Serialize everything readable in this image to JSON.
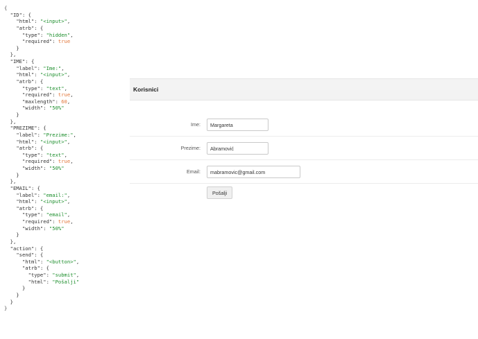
{
  "code": {
    "ID_key": "\"ID\"",
    "ID_html": "\"<input>\"",
    "ID_type": "\"hidden\"",
    "ID_required": "true",
    "IME_key": "\"IME\"",
    "IME_label": "\"Ime:\"",
    "IME_html": "\"<input>\"",
    "IME_type": "\"text\"",
    "IME_required": "true",
    "IME_maxlength": "60",
    "IME_width": "\"50%\"",
    "PREZIME_key": "\"PREZIME\"",
    "PREZIME_label": "\"Prezime:\"",
    "PREZIME_html": "\"<input>\"",
    "PREZIME_type": "\"text\"",
    "PREZIME_required": "true",
    "PREZIME_width": "\"50%\"",
    "EMAIL_key": "\"EMAIL\"",
    "EMAIL_label": "\"email:\"",
    "EMAIL_html": "\"<input>\"",
    "EMAIL_type": "\"email\"",
    "EMAIL_required": "true",
    "EMAIL_width": "\"50%\"",
    "action_key": "\"action\"",
    "send_key": "\"send\"",
    "send_html": "\"<button>\"",
    "send_type": "\"submit\"",
    "send_label_html": "\"Pošalji\""
  },
  "form": {
    "title": "Korisnici",
    "fields": [
      {
        "label": "Ime:",
        "value": "Margareta"
      },
      {
        "label": "Prezime:",
        "value": "Abramović"
      },
      {
        "label": "Email:",
        "value": "mabramovic@gmail.com"
      }
    ],
    "submit_label": "Pošalji"
  }
}
